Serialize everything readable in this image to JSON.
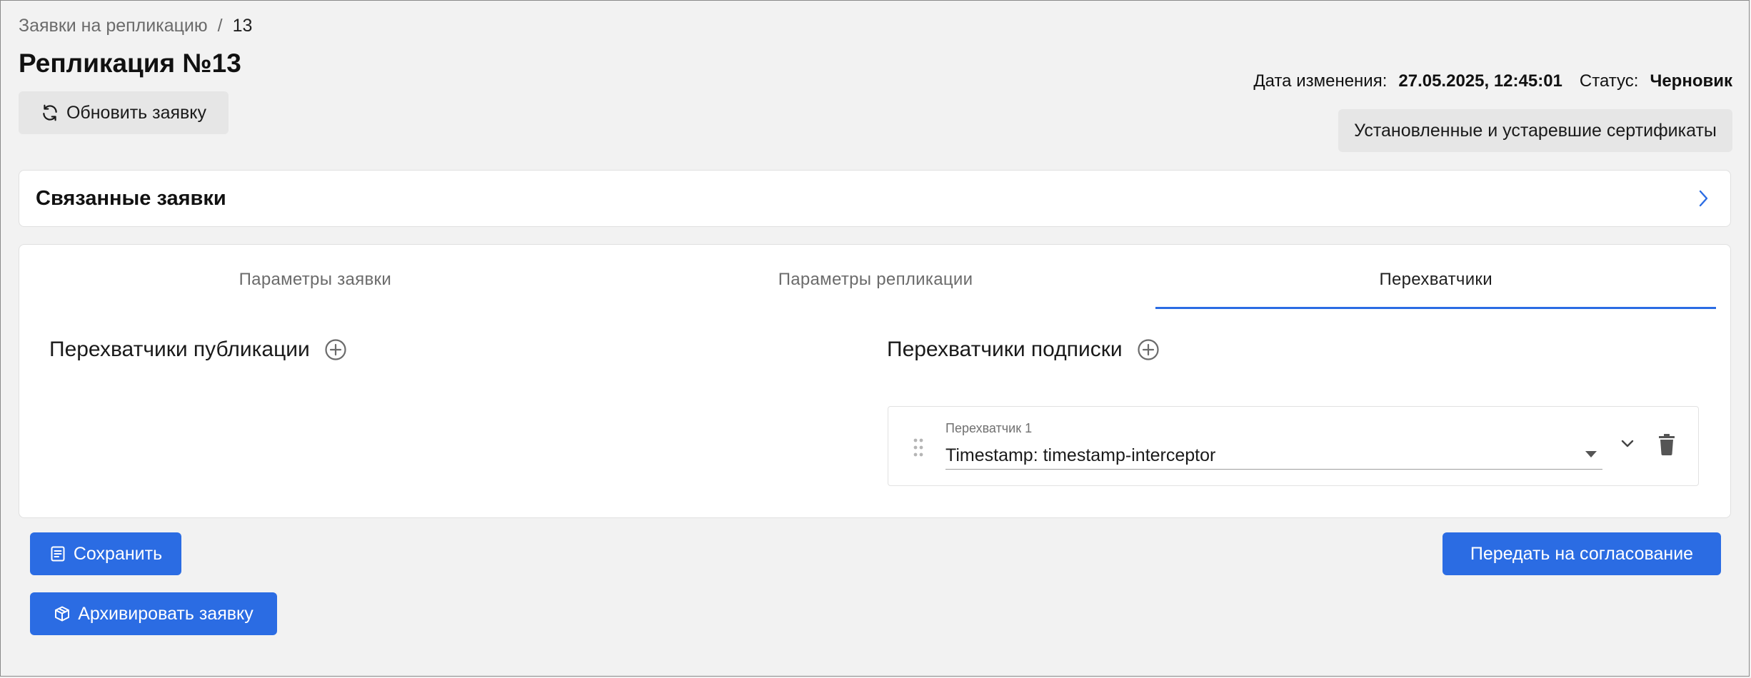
{
  "breadcrumb": {
    "parent": "Заявки на репликацию",
    "separator": "/",
    "current": "13"
  },
  "page_title": "Репликация №13",
  "refresh_button": {
    "label": "Обновить заявку",
    "icon": "refresh-icon"
  },
  "meta": {
    "modified_label": "Дата изменения:",
    "modified_value": "27.05.2025, 12:45:01",
    "status_label": "Статус:",
    "status_value": "Черновик"
  },
  "certs_button": {
    "label": "Установленные и устаревшие сертификаты"
  },
  "related": {
    "title": "Связанные заявки",
    "icon": "chevron-right-icon"
  },
  "tabs": [
    {
      "label": "Параметры заявки",
      "active": false
    },
    {
      "label": "Параметры репликации",
      "active": false
    },
    {
      "label": "Перехватчики",
      "active": true
    }
  ],
  "publication": {
    "title": "Перехватчики публикации",
    "add_icon": "add-circle-icon"
  },
  "subscription": {
    "title": "Перехватчики подписки",
    "add_icon": "add-circle-icon",
    "interceptors": [
      {
        "label": "Перехватчик 1",
        "value": "Timestamp: timestamp-interceptor"
      }
    ]
  },
  "actions": {
    "save": "Сохранить",
    "submit": "Передать на согласование",
    "archive": "Архивировать заявку"
  },
  "colors": {
    "accent": "#2b6ce3",
    "background": "#f2f2f2",
    "card": "#ffffff",
    "grey_button": "#e6e6e6"
  }
}
